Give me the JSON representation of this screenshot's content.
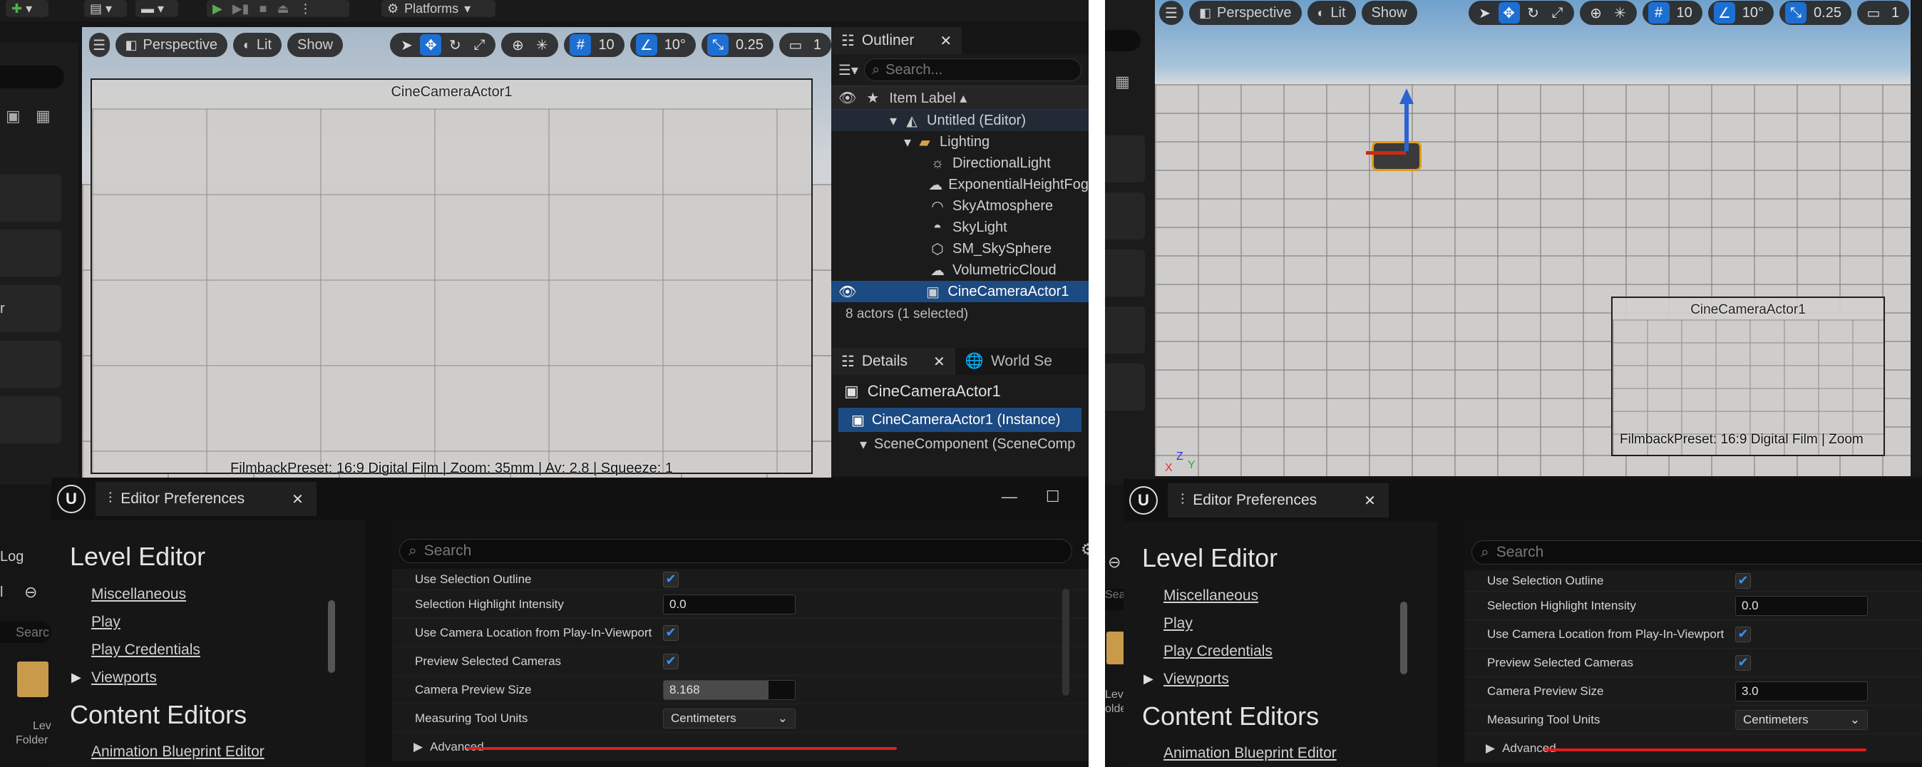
{
  "left": {
    "toolbar": {
      "platforms": "Platforms"
    },
    "viewport": {
      "perspective": "Perspective",
      "lit": "Lit",
      "show": "Show",
      "grid_snap": "10",
      "rot_snap": "10°",
      "scale_snap": "0.25",
      "cam_speed": "1",
      "cine_title": "CineCameraActor1",
      "filmback": "FilmbackPreset: 16:9 Digital Film | Zoom: 35mm | Av: 2.8 | Squeeze: 1"
    },
    "outliner": {
      "tab": "Outliner",
      "search_placeholder": "Search...",
      "column": "Item Label ▴",
      "rows": [
        {
          "label": "Untitled (Editor)",
          "icon": "level-icon"
        },
        {
          "label": "Lighting",
          "icon": "folder-icon"
        },
        {
          "label": "DirectionalLight",
          "icon": "sun-icon"
        },
        {
          "label": "ExponentialHeightFog",
          "icon": "fog-icon"
        },
        {
          "label": "SkyAtmosphere",
          "icon": "atmosphere-icon"
        },
        {
          "label": "SkyLight",
          "icon": "skylight-icon"
        },
        {
          "label": "SM_SkySphere",
          "icon": "mesh-icon"
        },
        {
          "label": "VolumetricCloud",
          "icon": "cloud-icon"
        },
        {
          "label": "CineCameraActor1",
          "icon": "camera-icon"
        }
      ],
      "footer": "8 actors (1 selected)"
    },
    "details": {
      "tab": "Details",
      "tab2": "World Se",
      "title": "CineCameraActor1",
      "instance": "CineCameraActor1 (Instance)",
      "scene": "SceneComponent (SceneComp"
    },
    "prefs": {
      "tab": "Editor Preferences",
      "search_placeholder": "Search",
      "nav_h1": "Level Editor",
      "nav_links": [
        "Miscellaneous",
        "Play",
        "Play Credentials",
        "Viewports"
      ],
      "nav_h2": "Content Editors",
      "nav_link2": "Animation Blueprint Editor",
      "props": [
        {
          "name": "Use Selection Outline",
          "kind": "check"
        },
        {
          "name": "Selection Highlight Intensity",
          "kind": "number",
          "value": "0.0"
        },
        {
          "name": "Use Camera Location from Play-In-Viewport",
          "kind": "check"
        },
        {
          "name": "Preview Selected Cameras",
          "kind": "check"
        },
        {
          "name": "Camera Preview Size",
          "kind": "number",
          "value": "8.168",
          "fill": 0.8
        },
        {
          "name": "Measuring Tool Units",
          "kind": "dropdown",
          "value": "Centimeters"
        }
      ],
      "advanced": "Advanced"
    },
    "side_stub": {
      "log": "Log",
      "search": "Searc",
      "folder": "Lev",
      "folder2": "Folder",
      "r": "r",
      "l": "l"
    }
  },
  "right": {
    "viewport": {
      "perspective": "Perspective",
      "lit": "Lit",
      "show": "Show",
      "grid_snap": "10",
      "rot_snap": "10°",
      "scale_snap": "0.25",
      "cam_speed": "1",
      "cine_title": "CineCameraActor1",
      "filmback": "FilmbackPreset: 16:9 Digital Film | Zoom"
    },
    "prefs": {
      "tab": "Editor Preferences",
      "search_placeholder": "Search",
      "nav_h1": "Level Editor",
      "nav_links": [
        "Miscellaneous",
        "Play",
        "Play Credentials",
        "Viewports"
      ],
      "nav_h2": "Content Editors",
      "nav_link2": "Animation Blueprint Editor",
      "props": [
        {
          "name": "Use Selection Outline",
          "kind": "check"
        },
        {
          "name": "Selection Highlight Intensity",
          "kind": "number",
          "value": "0.0"
        },
        {
          "name": "Use Camera Location from Play-In-Viewport",
          "kind": "check"
        },
        {
          "name": "Preview Selected Cameras",
          "kind": "check"
        },
        {
          "name": "Camera Preview Size",
          "kind": "number",
          "value": "3.0",
          "fill": 0
        },
        {
          "name": "Measuring Tool Units",
          "kind": "dropdown",
          "value": "Centimeters"
        }
      ],
      "advanced": "Advanced"
    },
    "side_stub": {
      "lev": "Lev",
      "older": "older",
      "sear": "Sear"
    },
    "axis": {
      "x": "X",
      "y": "Y",
      "z": "Z"
    }
  },
  "colors": {
    "accent_blue": "#1d6fd1",
    "red_underline": "#e01e1e",
    "selection": "#1c4a82"
  }
}
